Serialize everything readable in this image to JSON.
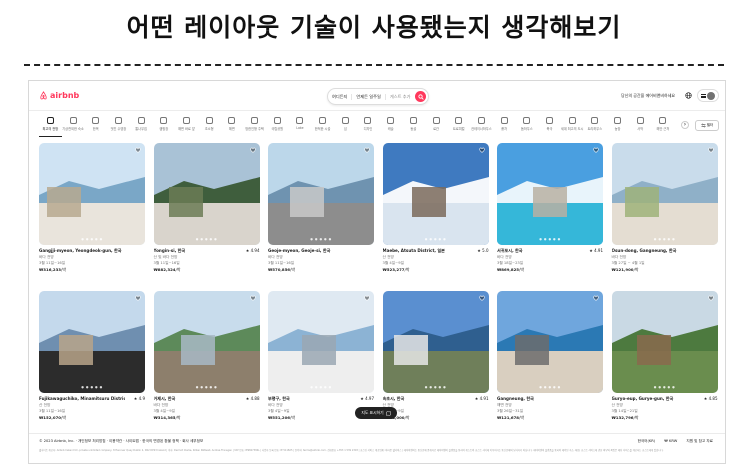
{
  "heading": "어떤 레이아웃 기술이 사용됐는지 생각해보기",
  "header": {
    "logo": "airbnb",
    "search": {
      "where": "여디든지",
      "when": "언제든 일주일",
      "who": "게스트 추가"
    },
    "host_link": "당신의 공간을 에어비앤비하세요"
  },
  "categories": [
    {
      "label": "최고의 전망",
      "active": true
    },
    {
      "label": "기상천외한 숙소"
    },
    {
      "label": "한옥"
    },
    {
      "label": "멋진 수영장"
    },
    {
      "label": "통나무집"
    },
    {
      "label": "캠핑장"
    },
    {
      "label": "해변 바로 앞"
    },
    {
      "label": "초소형"
    },
    {
      "label": "해변"
    },
    {
      "label": "방한인형 주택"
    },
    {
      "label": "국립공원"
    },
    {
      "label": "Lake"
    },
    {
      "label": "한적한 시골"
    },
    {
      "label": "섬"
    },
    {
      "label": "디자인"
    },
    {
      "label": "캐슬"
    },
    {
      "label": "동굴"
    },
    {
      "label": "료칸"
    },
    {
      "label": "트로피컬"
    },
    {
      "label": "컨테이너하우스"
    },
    {
      "label": "풍차"
    },
    {
      "label": "돔하우스"
    },
    {
      "label": "북극"
    },
    {
      "label": "세계 최고의 도시"
    },
    {
      "label": "트리하우스"
    },
    {
      "label": "농장"
    },
    {
      "label": "사막"
    },
    {
      "label": "해안 근처"
    }
  ],
  "filter_label": "필터",
  "listings": [
    {
      "title": "Gangjji-myeon, Yeongdeok-gun, 한국",
      "rating": "",
      "line1": "바다 전망",
      "line2": "3월 11일~16일",
      "price": "₩316,233",
      "unit": "/박"
    },
    {
      "title": "Yongin-si, 한국",
      "rating": "★ 4.94",
      "line1": "산 및 바다 전망",
      "line2": "3월 11일~16일",
      "price": "₩882,324",
      "unit": "/박"
    },
    {
      "title": "Geoje-myeon, Geoje-si, 한국",
      "rating": "",
      "line1": "바다 전망",
      "line2": "3월 11일~16일",
      "price": "₩570,856",
      "unit": "/박"
    },
    {
      "title": "Maebe, Atsuta District, 일본",
      "rating": "★ 5.0",
      "line1": "산 전망",
      "line2": "3월 4일~9일",
      "price": "₩523,277",
      "unit": "/박"
    },
    {
      "title": "서귀포시, 한국",
      "rating": "★ 4.91",
      "line1": "바다 전망",
      "line2": "3월 18일~23일",
      "price": "₩869,825",
      "unit": "/박"
    },
    {
      "title": "Osun-dong, Gangneung, 한국",
      "rating": "",
      "line1": "바다 전망",
      "line2": "3월 27일 ~ 4월 1일",
      "price": "₩121,900",
      "unit": "/박"
    },
    {
      "title": "Fujikawaguchiko, Minamitsuru District, 일본",
      "rating": "★ 4.9",
      "line1": "산 전망",
      "line2": "3월 11일~16일",
      "price": "₩152,070",
      "unit": "/박"
    },
    {
      "title": "거제시, 한국",
      "rating": "★ 4.88",
      "line1": "바다 전망",
      "line2": "3월 4일~9일",
      "price": "₩314,365",
      "unit": "/박"
    },
    {
      "title": "부평구, 한국",
      "rating": "★ 4.97",
      "line1": "바다 전망",
      "line2": "3월 4일~9일",
      "price": "₩551,206",
      "unit": "/박"
    },
    {
      "title": "속초시, 한국",
      "rating": "★ 4.91",
      "line1": "산 전망",
      "line2": "3월 4일~9일",
      "price": "₩238,000",
      "unit": "/박"
    },
    {
      "title": "Gangneung, 한국",
      "rating": "",
      "line1": "해변 전망",
      "line2": "3월 26일~31일",
      "price": "₩121,678",
      "unit": "/박"
    },
    {
      "title": "Guryo-eup, Gurye-gun, 한국",
      "rating": "★ 4.85",
      "line1": "산 전망",
      "line2": "3월 14일~21일",
      "price": "₩132,796",
      "unit": "/박"
    }
  ],
  "map_button": "지도 표시하기",
  "footer": {
    "left": "© 2023 Airbnb, Inc. · 개인정보 처리방침 · 이용약관 · 사이트맵 · 한국의 변경된 환불 정책 · 회사 세부정보",
    "language": "한국어(KR)",
    "currency": "₩ KRW",
    "support": "지원 및 참고 자료",
    "fine": "웹사이트 제공자: Airbnb Ireland UC, private unlimited company, 8 Hanover Quay Dublin 2, D02 DP23 Ireland | 이사: Dermot Clarke, Killian Pattwell, Andrea Finnegan | VAT 번호: IE9827384L | 사업자 등록 번호: IE 511825 | 연락처: terms@airbnb.com, 전화번호 +353 1 539 2303 | 호스팅 서비스 제공업체: 아마존 웹서비스 | 에어비앤비는 통신판매 중개자로 에어비앤비 플랫폼을 통하여 게스트와 호스트 사이에 이루어지는 통신판매의 당사자가 아닙니다. 에어비앤비 플랫폼을 통하여 예약된 숙소, 체험, 호스트 서비스에 관한 의무와 책임은 해당 서비스를 제공하는 호스트에게 있습니다."
  }
}
